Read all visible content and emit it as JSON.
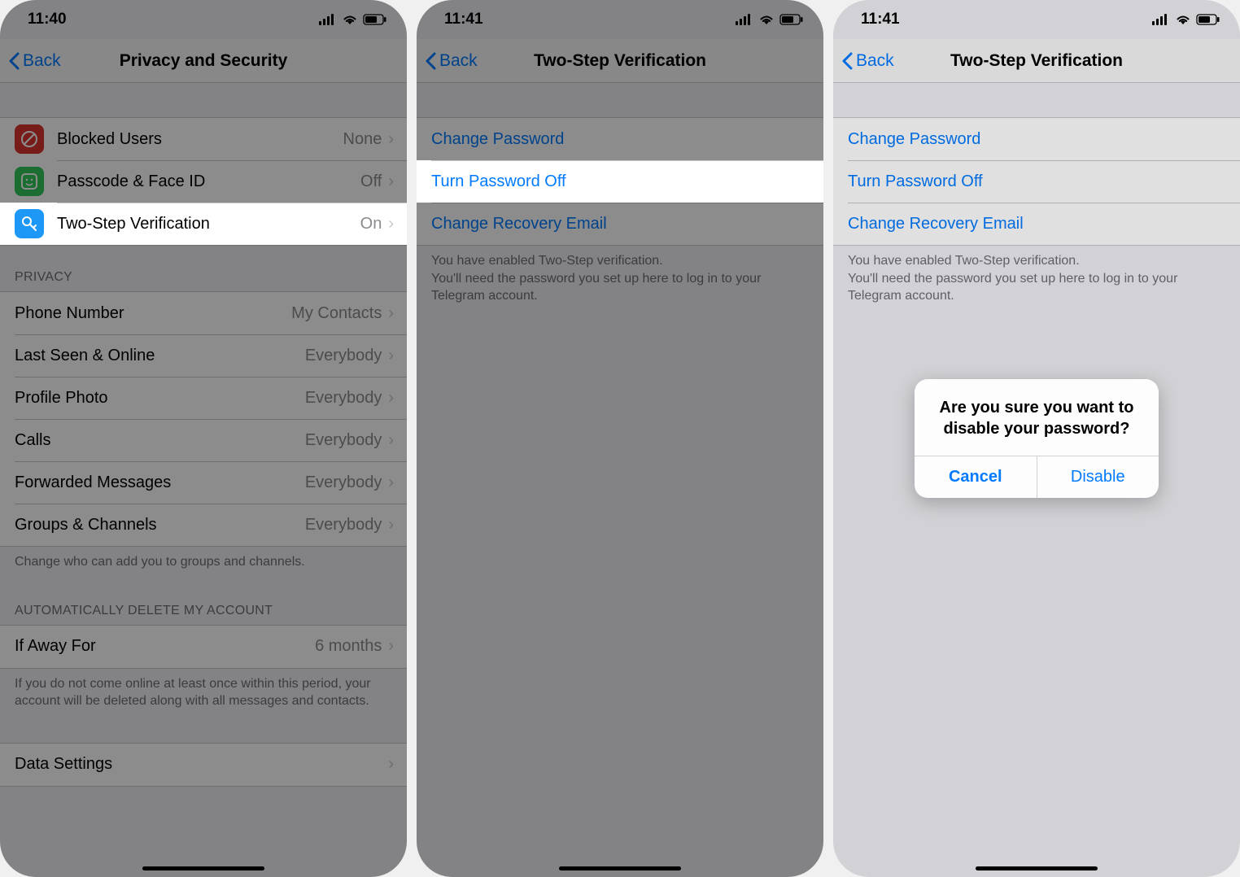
{
  "screen1": {
    "time": "11:40",
    "nav": {
      "back": "Back",
      "title": "Privacy and Security"
    },
    "security": [
      {
        "label": "Blocked Users",
        "value": "None",
        "iconColor": "#d9342c",
        "icon": "blocked"
      },
      {
        "label": "Passcode & Face ID",
        "value": "Off",
        "iconColor": "#34c759",
        "icon": "faceid"
      },
      {
        "label": "Two-Step Verification",
        "value": "On",
        "iconColor": "#1e98f6",
        "icon": "key"
      }
    ],
    "privacyHeader": "PRIVACY",
    "privacy": [
      {
        "label": "Phone Number",
        "value": "My Contacts"
      },
      {
        "label": "Last Seen & Online",
        "value": "Everybody"
      },
      {
        "label": "Profile Photo",
        "value": "Everybody"
      },
      {
        "label": "Calls",
        "value": "Everybody"
      },
      {
        "label": "Forwarded Messages",
        "value": "Everybody"
      },
      {
        "label": "Groups & Channels",
        "value": "Everybody"
      }
    ],
    "privacyFooter": "Change who can add you to groups and channels.",
    "autoDeleteHeader": "AUTOMATICALLY DELETE MY ACCOUNT",
    "autoDelete": {
      "label": "If Away For",
      "value": "6 months"
    },
    "autoDeleteFooter": "If you do not come online at least once within this period, your account will be deleted along with all messages and contacts.",
    "dataSettings": "Data Settings"
  },
  "screen2": {
    "time": "11:41",
    "nav": {
      "back": "Back",
      "title": "Two-Step Verification"
    },
    "options": [
      {
        "label": "Change Password"
      },
      {
        "label": "Turn Password Off"
      },
      {
        "label": "Change Recovery Email"
      }
    ],
    "footer": "You have enabled Two-Step verification.\nYou'll need the password you set up here to log in to your Telegram account."
  },
  "screen3": {
    "time": "11:41",
    "nav": {
      "back": "Back",
      "title": "Two-Step Verification"
    },
    "options": [
      {
        "label": "Change Password"
      },
      {
        "label": "Turn Password Off"
      },
      {
        "label": "Change Recovery Email"
      }
    ],
    "footer": "You have enabled Two-Step verification.\nYou'll need the password you set up here to log in to your Telegram account.",
    "alert": {
      "title": "Are you sure you want to disable your password?",
      "cancel": "Cancel",
      "confirm": "Disable"
    }
  }
}
